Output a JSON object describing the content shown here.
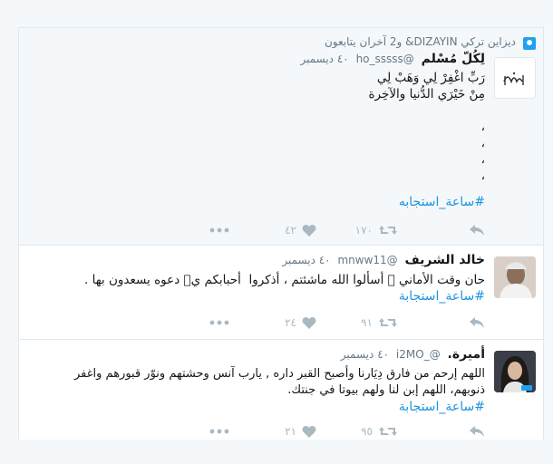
{
  "tweets": [
    {
      "context": "ديزاين تركي DIZAYIN& و2 آخران يتابعون",
      "name": "لِكُلّ مُسْلم",
      "handle": "@ho_sssss",
      "time": "٤٠ ديسمبر",
      "text": "رَبِّ اغْفِرْ لِي وَهَبْ لِي\nمِنْ خَيْرَي الدُّنيا والآخِرة\n\n،\n،\n،\n،",
      "hashtag": "#ساعة_استجابه",
      "retweets": "١٧٠",
      "likes": "٤٢",
      "avatar_color": "#ffffff"
    },
    {
      "name": "خالد الشريف",
      "handle": "@mnww11",
      "time": "٤٠ ديسمبر",
      "text": "حان وقت الأماني ۛ أسألوا الله ماشئتم ، أذكروا  أحبابكم يۛ دعوه يسعدون بها .",
      "hashtag": "#ساعة_استجابة",
      "retweets": "٩١",
      "likes": "٢٤",
      "avatar_color": "#8b6f5a"
    },
    {
      "name": "أميرة.",
      "handle": "@_i2MO",
      "time": "٤٠ ديسمبر",
      "text": "اللهم إرحم من فارق دِيَارنا وأصبح القبر داره , يارب آنس وحشتهم ونوّر قبورهم واغفر\nذنوبهم، اللهم إبن لنا ولهم بيوتا في جنتك.",
      "hashtag": "#ساعة_استجابة",
      "retweets": "٩٥",
      "likes": "٢١",
      "avatar_color": "#2a2a2e"
    }
  ],
  "colors": {
    "accent": "#1b95e0",
    "muted": "#657786",
    "icon": "#aab8c2"
  }
}
